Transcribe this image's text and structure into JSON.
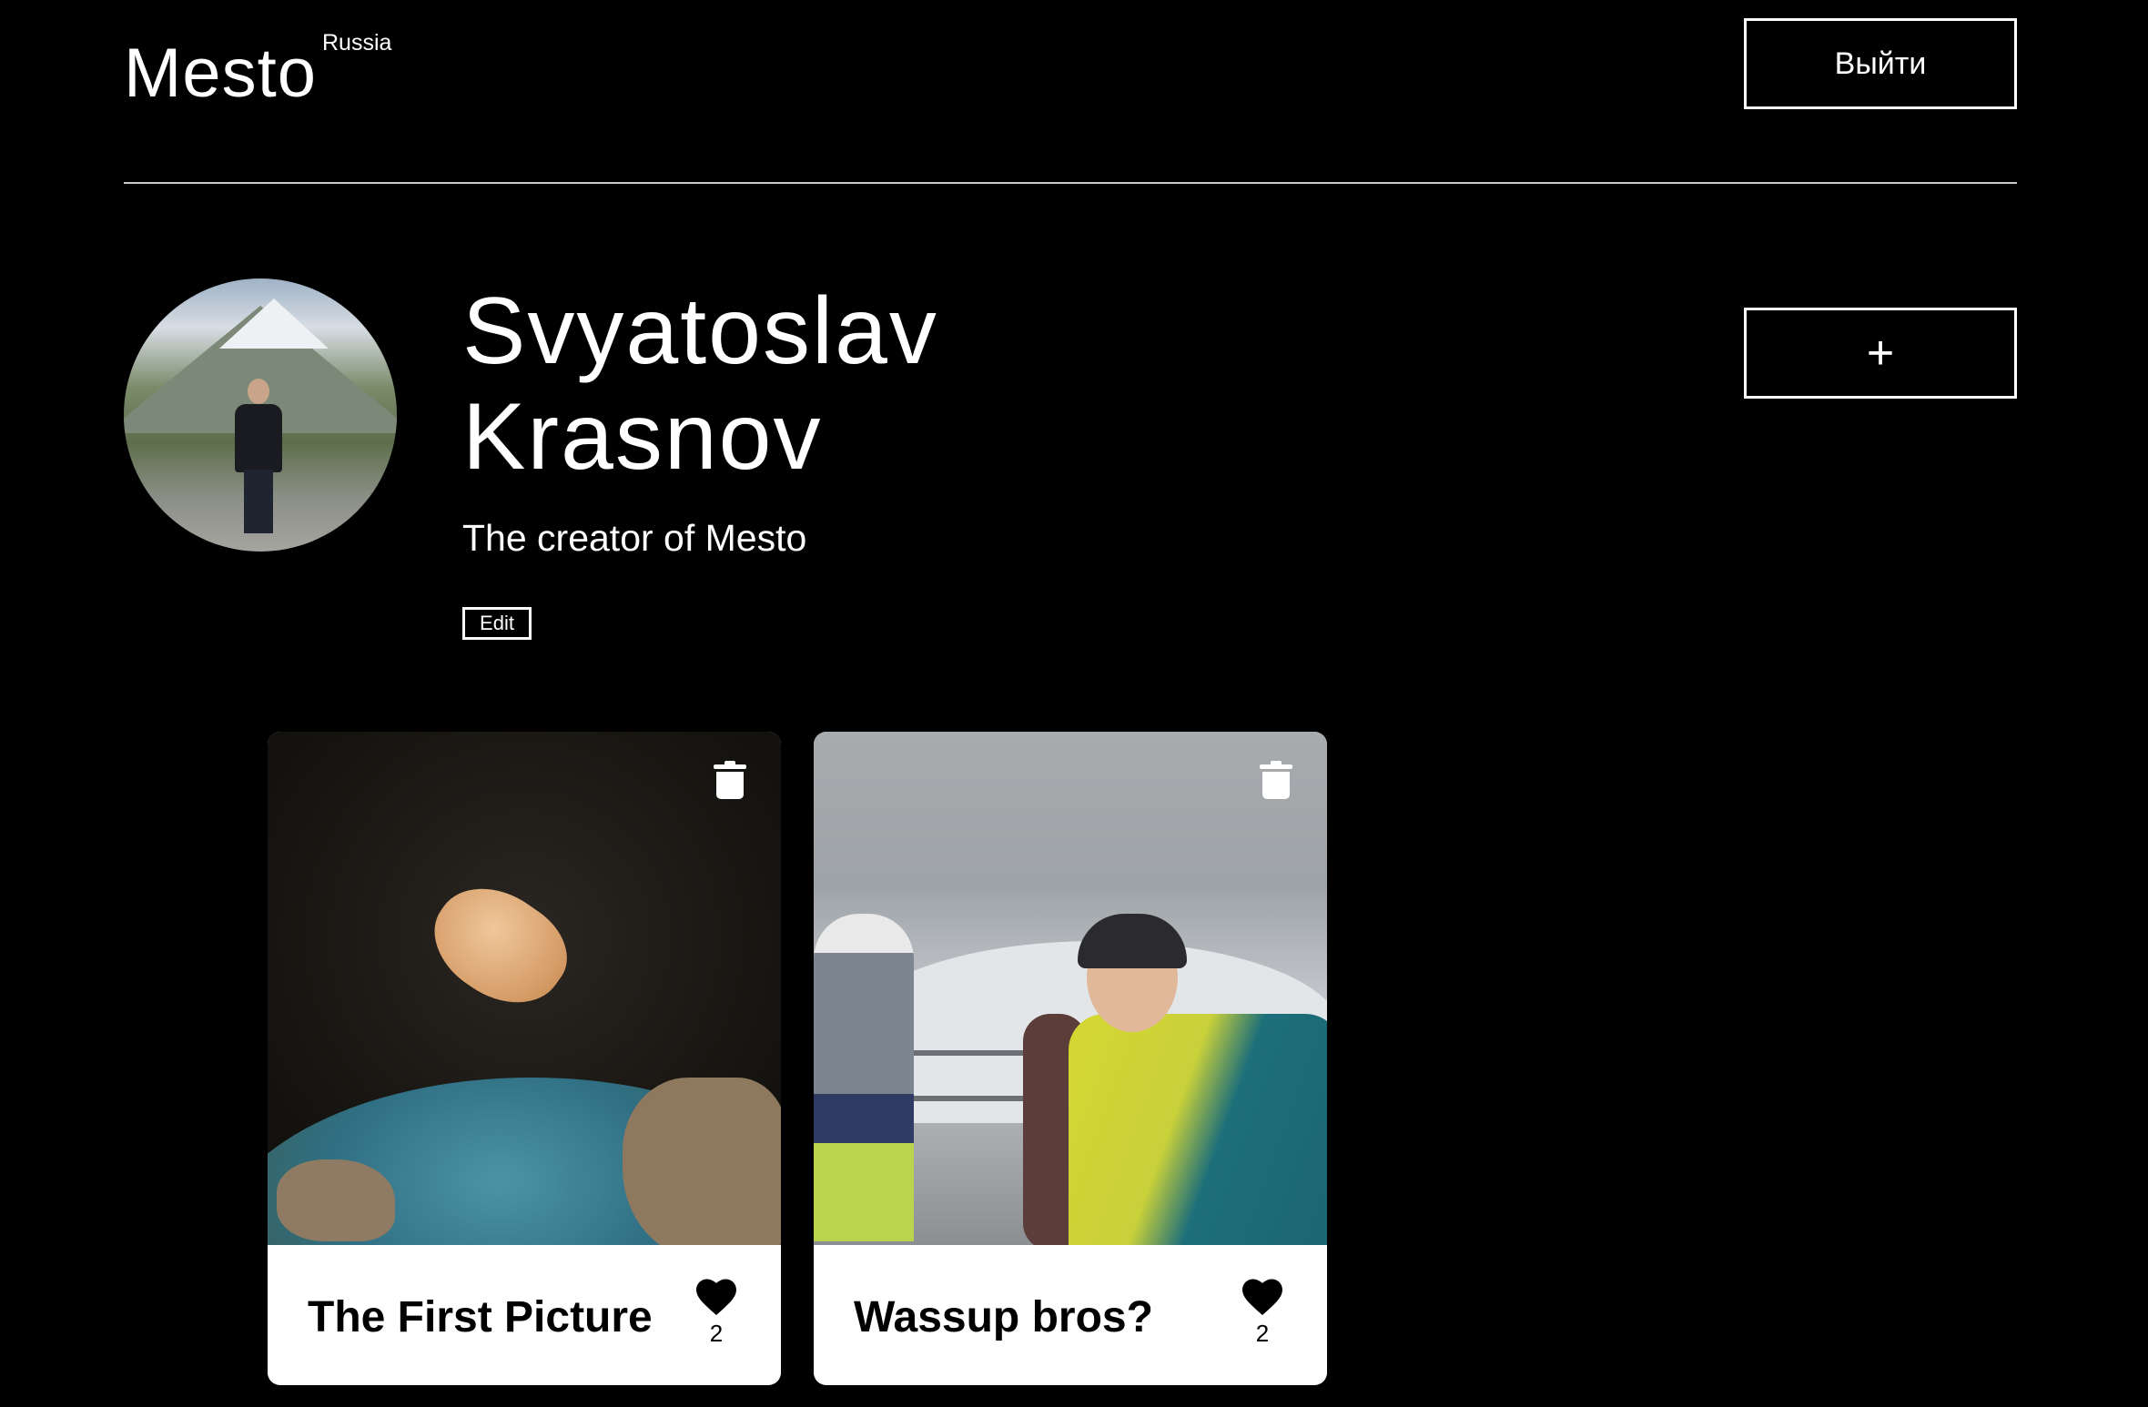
{
  "header": {
    "logo": "Mesto",
    "logo_sub": "Russia",
    "logout_label": "Выйти"
  },
  "profile": {
    "name": "Svyatoslav Krasnov",
    "about": "The creator of Mesto",
    "edit_label": "Edit",
    "add_label": "+"
  },
  "cards": [
    {
      "title": "The First Picture",
      "likes": "2"
    },
    {
      "title": "Wassup bros?",
      "likes": "2"
    }
  ],
  "icons": {
    "delete": "trash-icon",
    "like": "heart-icon"
  },
  "colors": {
    "background": "#000000",
    "text": "#ffffff",
    "card_footer": "#ffffff"
  }
}
